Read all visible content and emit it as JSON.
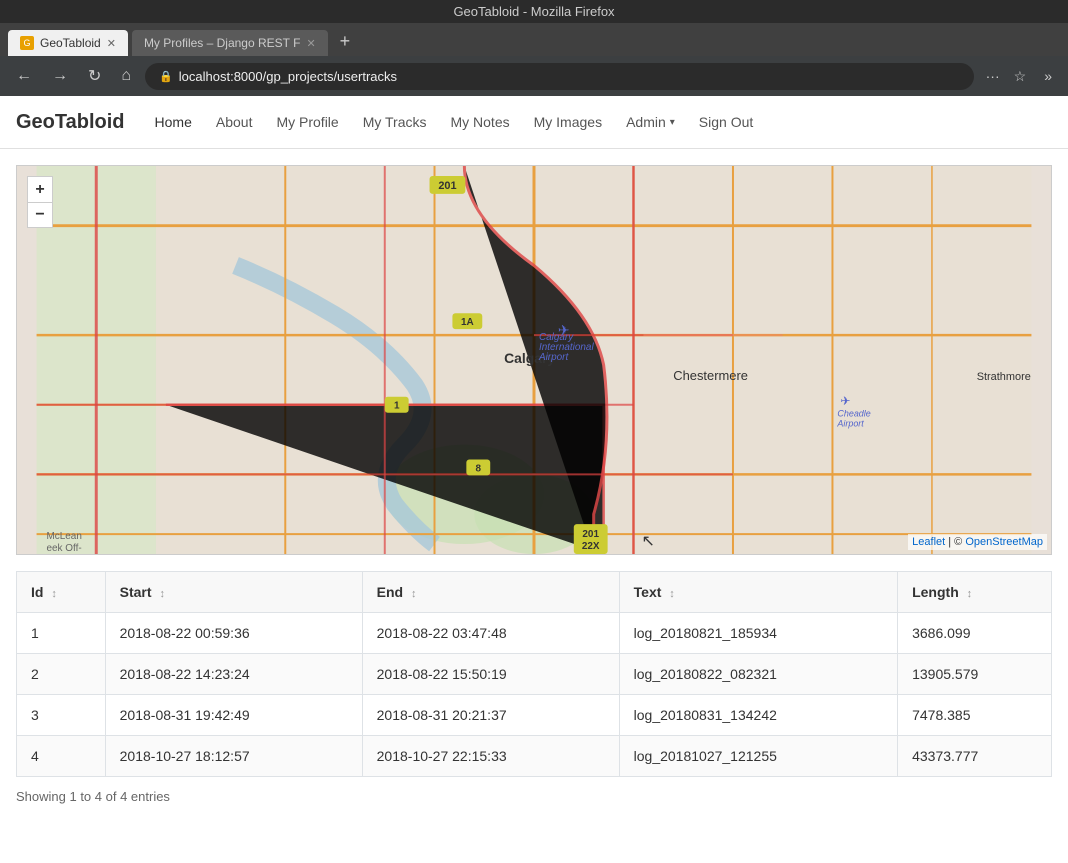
{
  "browser": {
    "title": "GeoTabloid - Mozilla Firefox",
    "tabs": [
      {
        "label": "GeoTabloid",
        "active": true,
        "favicon": "G"
      },
      {
        "label": "My Profiles – Django REST F",
        "active": false,
        "favicon": ""
      }
    ],
    "new_tab_icon": "+",
    "address": "localhost:8000/gp_projects/usertracks",
    "back_icon": "←",
    "forward_icon": "→",
    "refresh_icon": "↻",
    "home_icon": "⌂",
    "more_icon": "···",
    "bookmark_icon": "☆",
    "extensions_icon": "»"
  },
  "nav": {
    "brand": "GeoTabloid",
    "links": [
      {
        "label": "Home",
        "active": true
      },
      {
        "label": "About",
        "active": false
      },
      {
        "label": "My Profile",
        "active": false
      },
      {
        "label": "My Tracks",
        "active": false
      },
      {
        "label": "My Notes",
        "active": false
      },
      {
        "label": "My Images",
        "active": false
      }
    ],
    "admin_label": "Admin",
    "signout_label": "Sign Out"
  },
  "map": {
    "zoom_in": "+",
    "zoom_out": "−",
    "attribution_leaflet": "Leaflet",
    "attribution_osm": "OpenStreetMap",
    "attribution_separator": " | © "
  },
  "table": {
    "columns": [
      {
        "label": "Id",
        "sort": true
      },
      {
        "label": "Start",
        "sort": true
      },
      {
        "label": "End",
        "sort": true
      },
      {
        "label": "Text",
        "sort": true
      },
      {
        "label": "Length",
        "sort": true
      }
    ],
    "rows": [
      {
        "id": "1",
        "start": "2018-08-22 00:59:36",
        "end": "2018-08-22 03:47:48",
        "text": "log_20180821_185934",
        "length": "3686.099"
      },
      {
        "id": "2",
        "start": "2018-08-22 14:23:24",
        "end": "2018-08-22 15:50:19",
        "text": "log_20180822_082321",
        "length": "13905.579"
      },
      {
        "id": "3",
        "start": "2018-08-31 19:42:49",
        "end": "2018-08-31 20:21:37",
        "text": "log_20180831_134242",
        "length": "7478.385"
      },
      {
        "id": "4",
        "start": "2018-10-27 18:12:57",
        "end": "2018-10-27 22:15:33",
        "text": "log_20181027_121255",
        "length": "43373.777"
      }
    ],
    "info": "Showing 1 to 4 of 4 entries"
  }
}
